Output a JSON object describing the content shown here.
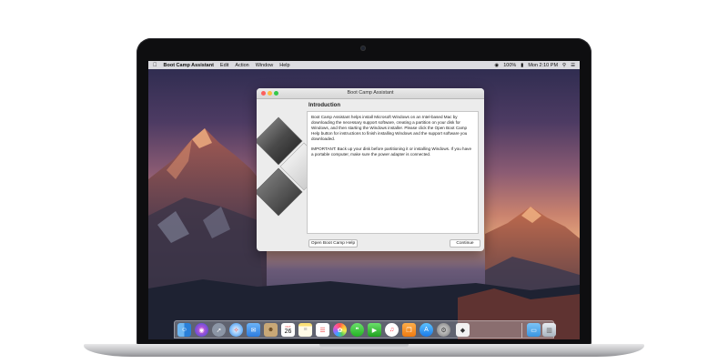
{
  "menubar": {
    "apple": "",
    "app_name": "Boot Camp Assistant",
    "items": [
      "Edit",
      "Action",
      "Window",
      "Help"
    ],
    "status": {
      "battery": "100%",
      "clock": "Mon 2:10 PM"
    }
  },
  "window": {
    "title": "Boot Camp Assistant",
    "section_title": "Introduction",
    "paragraphs": [
      "Boot Camp Assistant helps install Microsoft Windows on an Intel-based Mac by downloading the necessary support software, creating a partition on your disk for Windows, and then starting the Windows installer. Please click the Open Boot Camp Help button for instructions to finish installing Windows and the support software you downloaded.",
      "IMPORTANT: Back up your disk before partitioning it or installing Windows. If you have a portable computer, make sure the power adapter is connected."
    ],
    "help_button": "Open Boot Camp Help",
    "continue_button": "Continue"
  },
  "dock": {
    "calendar_month": "OCT",
    "calendar_day": "26",
    "icons": [
      "finder-icon",
      "siri-icon",
      "launchpad-icon",
      "safari-icon",
      "mail-icon",
      "contacts-icon",
      "calendar-icon",
      "notes-icon",
      "reminders-icon",
      "photos-icon",
      "messages-icon",
      "facetime-icon",
      "music-icon",
      "ibooks-icon",
      "app-store-icon",
      "system-preferences-icon",
      "boot-camp-icon",
      "downloads-folder-icon",
      "trash-icon"
    ]
  },
  "colors": {
    "close": "#fc605c",
    "minimize": "#fdbc40",
    "maximize": "#34c84a"
  }
}
